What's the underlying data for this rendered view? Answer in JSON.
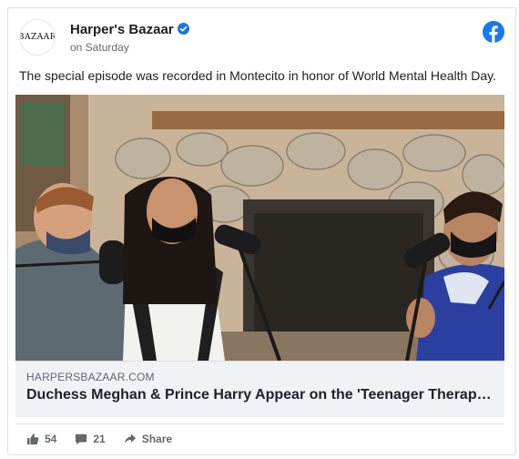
{
  "post": {
    "avatar_text": "BAZAAR",
    "page_name": "Harper's Bazaar",
    "time": "on Saturday",
    "caption": "The special episode was recorded in Montecito in honor of World Mental Health Day."
  },
  "link": {
    "domain": "HARPERSBAZAAR.COM",
    "title": "Duchess Meghan & Prince Harry Appear on the 'Teenager Therapy' Podcast"
  },
  "actions": {
    "likes": "54",
    "comments": "21",
    "share_label": "Share"
  },
  "colors": {
    "facebook_blue": "#1877f2",
    "verified_blue": "#1b74e4",
    "meta_gray": "#65676b"
  },
  "icons": [
    "facebook-logo-icon",
    "verified-badge-icon",
    "like-icon",
    "comment-icon",
    "share-icon"
  ]
}
